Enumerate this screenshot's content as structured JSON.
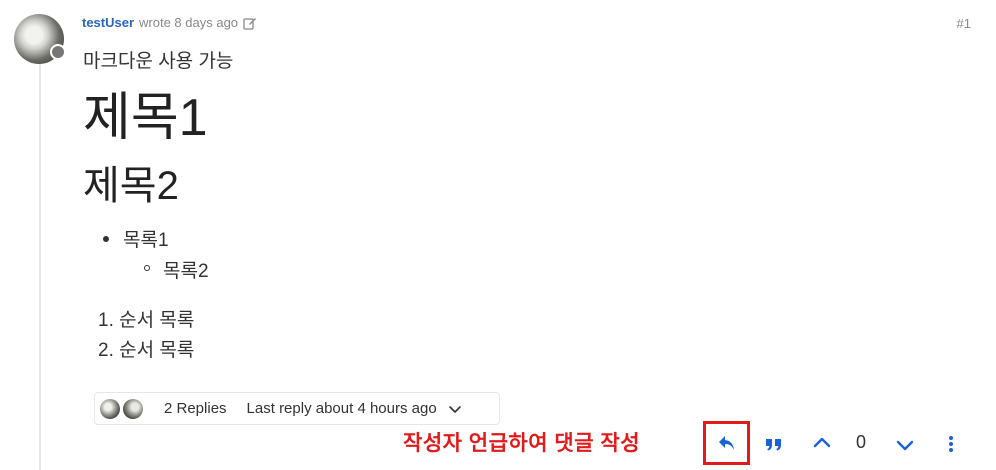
{
  "post": {
    "username": "testUser",
    "wrote": "wrote 8 days ago",
    "index": "#1"
  },
  "content": {
    "intro": "마크다운 사용 가능",
    "heading1": "제목1",
    "heading2": "제목2",
    "bullet_item": "목록1",
    "nested_item": "목록2",
    "ordered": [
      {
        "num": "1.",
        "text": "순서 목록"
      },
      {
        "num": "2.",
        "text": "순서 목록"
      }
    ]
  },
  "replies": {
    "count_label": "2 Replies",
    "last_reply_label": "Last reply about 4 hours ago"
  },
  "annotation": {
    "text": "작성자 언급하여 댓글 작성",
    "color": "#e01b1b"
  },
  "actions": {
    "vote_count": "0",
    "accent": "#1a62d6",
    "icons": [
      "reply-icon",
      "quote-icon",
      "upvote-icon",
      "downvote-icon",
      "more-options-icon"
    ]
  },
  "colors": {
    "username": "#2a66c6",
    "muted": "#888888"
  }
}
